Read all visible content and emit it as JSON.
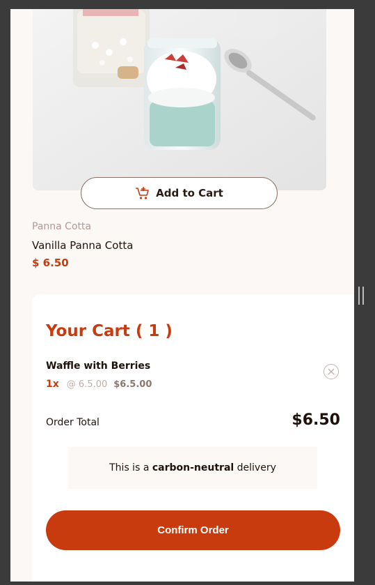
{
  "product": {
    "image_icon": "panna-cotta-jar-photo",
    "add_to_cart_label": "Add to Cart",
    "add_to_cart_icon": "add-to-cart-icon",
    "category": "Panna Cotta",
    "name": "Vanilla Panna Cotta",
    "price": "$ 6.50"
  },
  "cart": {
    "title": "Your Cart ( 1 )",
    "items": [
      {
        "name": "Waffle with Berries",
        "quantity": "1x",
        "unit_price": "@ 6.5.00",
        "subtotal": "$6.5.00",
        "remove_icon": "remove-item-icon"
      }
    ],
    "order_total_label": "Order Total",
    "order_total_value": "$6.50",
    "carbon": {
      "prefix": "This is a ",
      "emphasis": "carbon-neutral",
      "suffix": " delivery"
    },
    "confirm_label": "Confirm Order"
  },
  "colors": {
    "accent": "#c73b0f",
    "background": "#fcf8f5",
    "text": "#1f120d",
    "muted": "#b09a92"
  }
}
